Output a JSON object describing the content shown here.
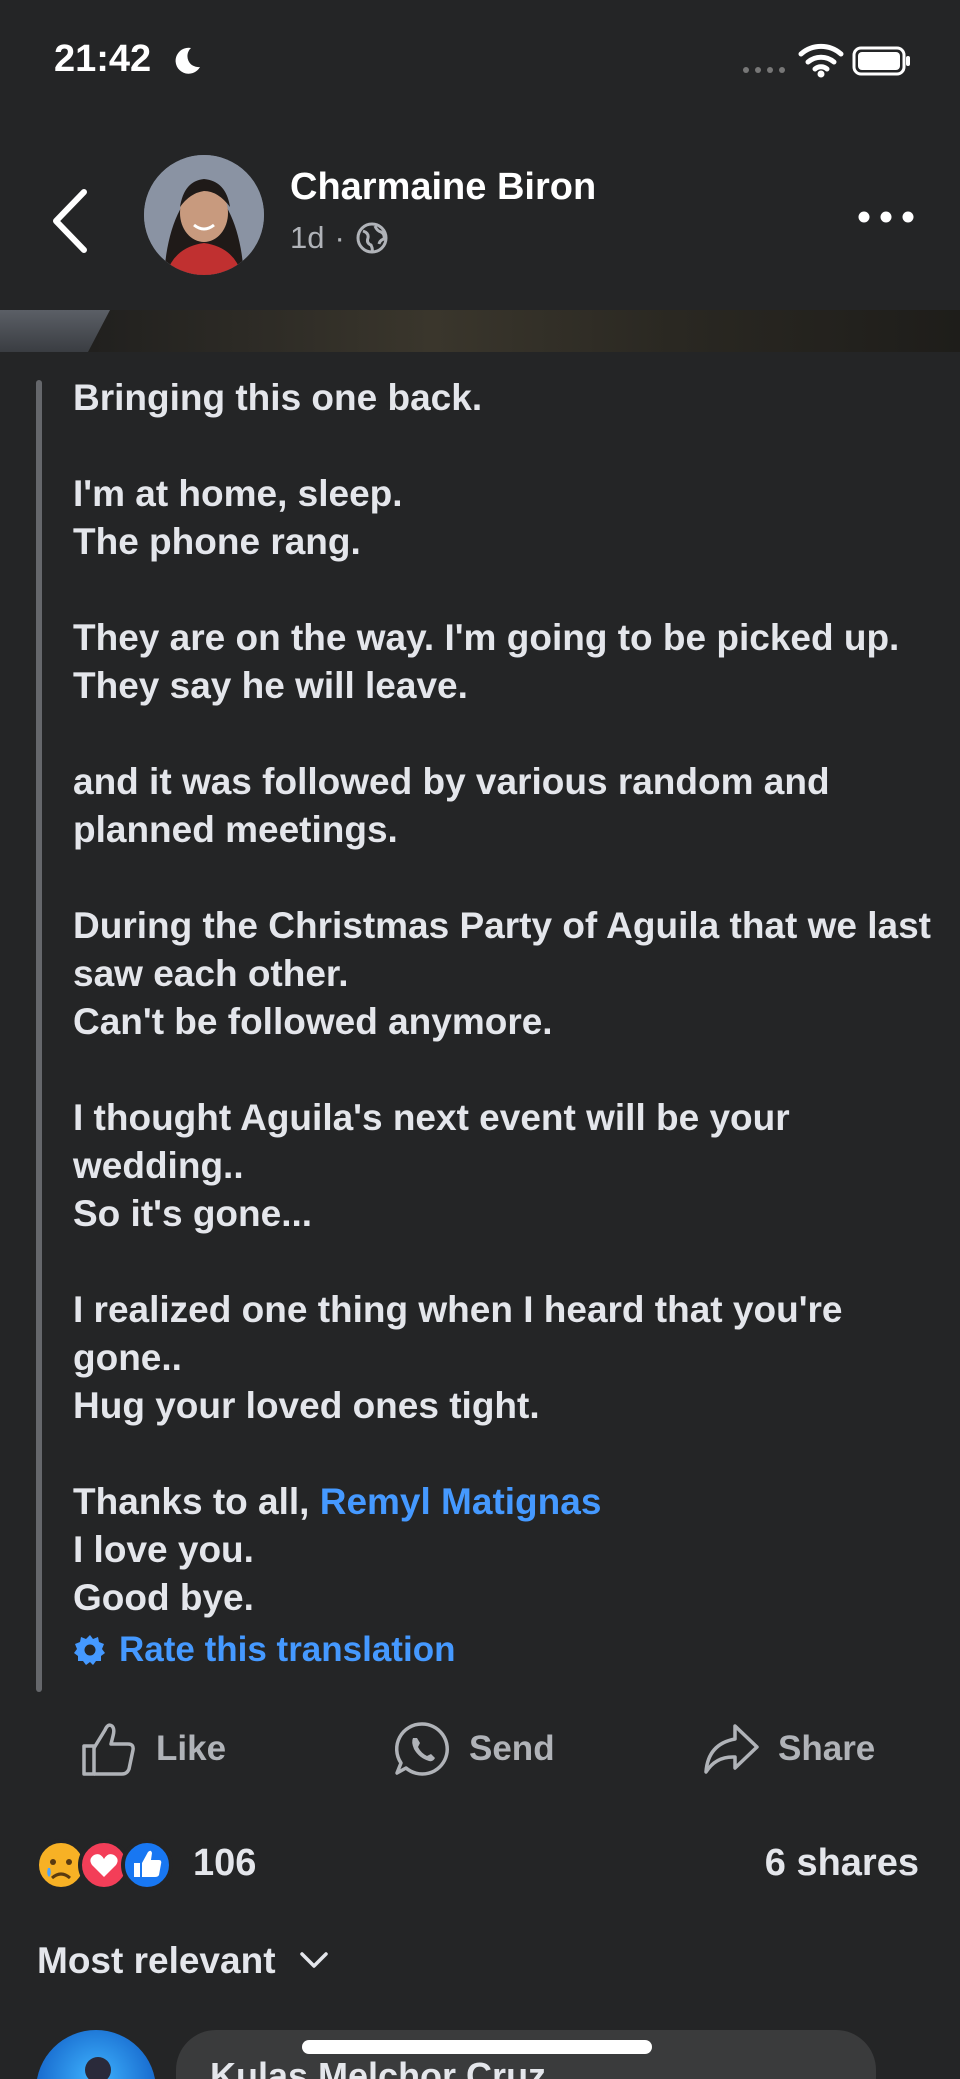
{
  "status_bar": {
    "time": "21:42",
    "icons": [
      "moon-icon",
      "signal-icon",
      "wifi-icon",
      "battery-icon"
    ]
  },
  "header": {
    "author": "Charmaine Biron",
    "time_ago": "1d",
    "separator": "·",
    "audience_icon": "globe-icon"
  },
  "post": {
    "paragraphs": [
      [
        "Bringing this one back."
      ],
      [
        "I'm at home, sleep.",
        "The phone rang."
      ],
      [
        "They are on the way. I'm going to be picked up. They say he will leave."
      ],
      [
        "and it was followed by various random and planned meetings."
      ],
      [
        "During the Christmas Party of Aguila that we last saw each other.",
        "Can't be followed anymore."
      ],
      [
        "I thought Aguila's next event will be your wedding..",
        "So it's gone..."
      ],
      [
        "I realized one thing when I heard that you're gone..",
        "Hug your loved ones tight."
      ]
    ],
    "closing": {
      "thanks_prefix": "Thanks to all, ",
      "mention": "Remyl Matignas",
      "line2": "I love you.",
      "line3": "Good bye."
    },
    "rate_translation": "Rate this translation"
  },
  "actions": {
    "like": "Like",
    "send": "Send",
    "share": "Share"
  },
  "reactions": {
    "types": [
      "sad",
      "love",
      "like"
    ],
    "count": "106",
    "shares": "6 shares"
  },
  "comments": {
    "sort_label": "Most relevant",
    "first_author": "Kulas Melchor Cruz"
  },
  "colors": {
    "background": "#242526",
    "text": "#e4e6eb",
    "secondary_text": "#b0b3b8",
    "link": "#4599ff"
  }
}
